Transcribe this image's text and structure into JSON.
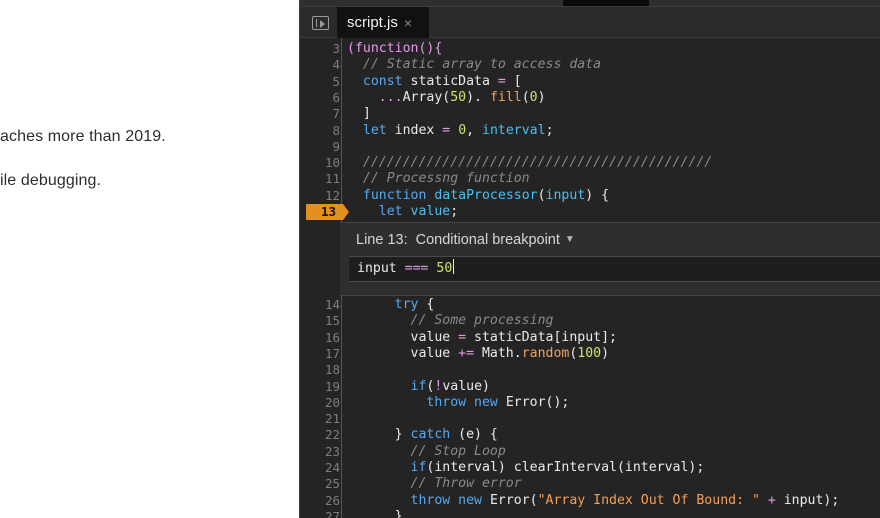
{
  "article": {
    "line1": "aches more than 2019.",
    "line2": "ile debugging."
  },
  "devtools": {
    "tab": {
      "label": "script.js",
      "close_glyph": "×"
    },
    "code_lines": [
      {
        "n": "3",
        "tokens": [
          [
            "op",
            "(function(){"
          ]
        ]
      },
      {
        "n": "4",
        "tokens": [
          [
            "t",
            "  "
          ],
          [
            "cm",
            "// Static array to access data"
          ]
        ]
      },
      {
        "n": "5",
        "tokens": [
          [
            "t",
            "  "
          ],
          [
            "kw",
            "const "
          ],
          [
            "t",
            "staticData "
          ],
          [
            "op",
            "= "
          ],
          [
            "t",
            "["
          ]
        ]
      },
      {
        "n": "6",
        "tokens": [
          [
            "t",
            "    "
          ],
          [
            "op",
            "..."
          ],
          [
            "t",
            "Array("
          ],
          [
            "num",
            "50"
          ],
          [
            "t",
            "). "
          ],
          [
            "method",
            "fill"
          ],
          [
            "t",
            "("
          ],
          [
            "num",
            "0"
          ],
          [
            "t",
            ")"
          ]
        ]
      },
      {
        "n": "7",
        "tokens": [
          [
            "t",
            "  ]"
          ]
        ]
      },
      {
        "n": "8",
        "tokens": [
          [
            "t",
            "  "
          ],
          [
            "kw",
            "let "
          ],
          [
            "t",
            "index "
          ],
          [
            "op",
            "= "
          ],
          [
            "num",
            "0"
          ],
          [
            "t",
            ", "
          ],
          [
            "fn",
            "interval"
          ],
          [
            "t",
            ";"
          ]
        ]
      },
      {
        "n": "9",
        "tokens": [
          [
            "t",
            ""
          ]
        ]
      },
      {
        "n": "10",
        "tokens": [
          [
            "t",
            "  "
          ],
          [
            "cm",
            "////////////////////////////////////////////"
          ]
        ]
      },
      {
        "n": "11",
        "tokens": [
          [
            "t",
            "  "
          ],
          [
            "cm",
            "// Processng function"
          ]
        ]
      },
      {
        "n": "12",
        "tokens": [
          [
            "t",
            "  "
          ],
          [
            "kw",
            "function "
          ],
          [
            "fn",
            "dataProcessor"
          ],
          [
            "t",
            "("
          ],
          [
            "fn",
            "input"
          ],
          [
            "t",
            ") {"
          ]
        ]
      },
      {
        "n": "13",
        "tokens": [
          [
            "t",
            "    "
          ],
          [
            "kw",
            "let "
          ],
          [
            "fn",
            "value"
          ],
          [
            "t",
            ";"
          ]
        ],
        "breakpoint": true
      }
    ],
    "breakpoint_editor": {
      "line_label": "Line 13:",
      "type_label": "Conditional breakpoint",
      "caret": "▼",
      "condition_tokens": [
        [
          "t",
          "input "
        ],
        [
          "op",
          "==="
        ],
        [
          "t",
          " "
        ],
        [
          "num",
          "50"
        ]
      ]
    },
    "code_lines_after": [
      {
        "n": "14",
        "tokens": [
          [
            "t",
            "      "
          ],
          [
            "kw",
            "try "
          ],
          [
            "t",
            "{"
          ]
        ]
      },
      {
        "n": "15",
        "tokens": [
          [
            "t",
            "        "
          ],
          [
            "cm",
            "// Some processing"
          ]
        ]
      },
      {
        "n": "16",
        "tokens": [
          [
            "t",
            "        value "
          ],
          [
            "op",
            "= "
          ],
          [
            "t",
            "staticData[input];"
          ]
        ]
      },
      {
        "n": "17",
        "tokens": [
          [
            "t",
            "        value "
          ],
          [
            "op",
            "+= "
          ],
          [
            "t",
            "Math."
          ],
          [
            "method",
            "random"
          ],
          [
            "t",
            "("
          ],
          [
            "num",
            "100"
          ],
          [
            "t",
            ")"
          ]
        ]
      },
      {
        "n": "18",
        "tokens": [
          [
            "t",
            ""
          ]
        ]
      },
      {
        "n": "19",
        "tokens": [
          [
            "t",
            "        "
          ],
          [
            "kw",
            "if"
          ],
          [
            "t",
            "("
          ],
          [
            "op",
            "!"
          ],
          [
            "t",
            "value)"
          ]
        ]
      },
      {
        "n": "20",
        "tokens": [
          [
            "t",
            "          "
          ],
          [
            "kw",
            "throw new "
          ],
          [
            "t",
            "Error();"
          ]
        ]
      },
      {
        "n": "21",
        "tokens": [
          [
            "t",
            ""
          ]
        ]
      },
      {
        "n": "22",
        "tokens": [
          [
            "t",
            "      } "
          ],
          [
            "kw",
            "catch "
          ],
          [
            "t",
            "(e) {"
          ]
        ]
      },
      {
        "n": "23",
        "tokens": [
          [
            "t",
            "        "
          ],
          [
            "cm",
            "// Stop Loop"
          ]
        ]
      },
      {
        "n": "24",
        "tokens": [
          [
            "t",
            "        "
          ],
          [
            "kw",
            "if"
          ],
          [
            "t",
            "(interval) clearInterval(interval);"
          ]
        ]
      },
      {
        "n": "25",
        "tokens": [
          [
            "t",
            "        "
          ],
          [
            "cm",
            "// Throw error"
          ]
        ]
      },
      {
        "n": "26",
        "tokens": [
          [
            "t",
            "        "
          ],
          [
            "kw",
            "throw new "
          ],
          [
            "t",
            "Error("
          ],
          [
            "str",
            "\"Array Index Out Of Bound: \""
          ],
          [
            "t",
            " "
          ],
          [
            "op",
            "+"
          ],
          [
            "t",
            " input);"
          ]
        ]
      },
      {
        "n": "27",
        "tokens": [
          [
            "t",
            "      }"
          ]
        ]
      }
    ]
  }
}
